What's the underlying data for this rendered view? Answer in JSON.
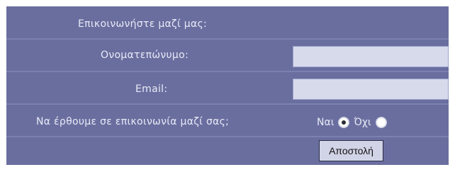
{
  "form": {
    "title": "Επικοινωνήστε μαζί μας:",
    "name_label": "Ονοματεπώνυμο:",
    "name_value": "",
    "email_label": "Email:",
    "email_value": "",
    "contact_question": "Να έρθουμε σε επικοινωνία μαζί σας;",
    "contact_options": [
      {
        "label": "Ναι",
        "selected": true
      },
      {
        "label": "Όχι",
        "selected": false
      }
    ],
    "submit_label": "Αποστολή"
  },
  "colors": {
    "panel_background": "#6a6e9f",
    "text": "#e8ebf6",
    "input_background": "#d7daeb",
    "button_background": "#d1d3e6"
  }
}
